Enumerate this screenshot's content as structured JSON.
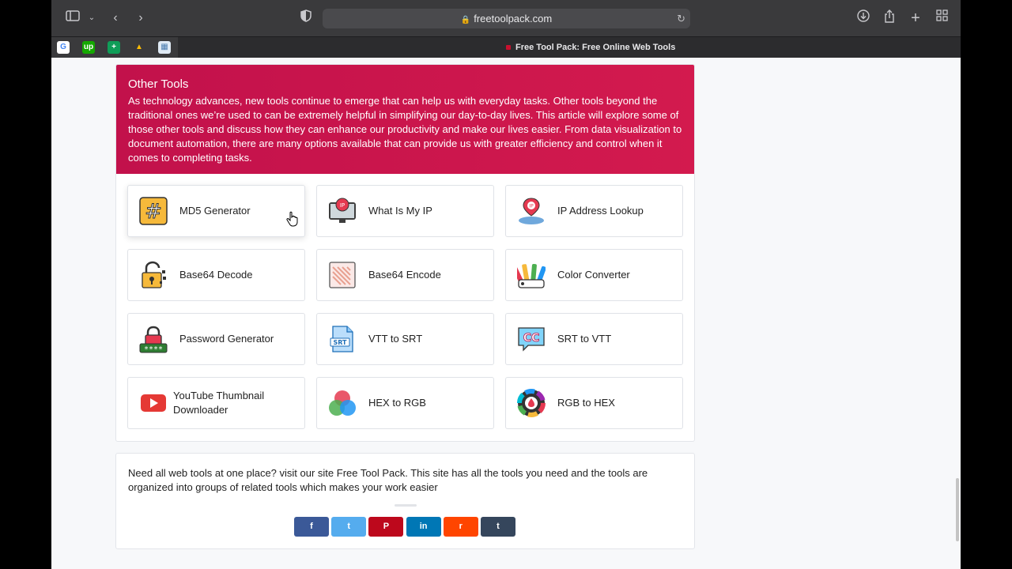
{
  "browser": {
    "url": "freetoolpack.com",
    "tab_title": "Free Tool Pack: Free Online Web Tools",
    "favorites": [
      {
        "name": "google",
        "glyph": "G",
        "color": "#ffffff",
        "text": "#4285f4"
      },
      {
        "name": "upwork",
        "glyph": "up",
        "color": "#14a800",
        "text": "#ffffff"
      },
      {
        "name": "sheets",
        "glyph": "+",
        "color": "#0f9d58",
        "text": "#ffffff"
      },
      {
        "name": "drive",
        "glyph": "▲",
        "color": "#3a3a3c",
        "text": "#fbbc04"
      },
      {
        "name": "app",
        "glyph": "▦",
        "color": "#dfeaf5",
        "text": "#4a7cb0"
      }
    ]
  },
  "hero": {
    "title": "Other Tools",
    "description": "As technology advances, new tools continue to emerge that can help us with everyday tasks. Other tools beyond the traditional ones we’re used to can be extremely helpful in simplifying our day-to-day lives. This article will explore some of those other tools and discuss how they can enhance our productivity and make our lives easier. From data visualization to document automation, there are many options available that can provide us with greater efficiency and control when it comes to completing tasks."
  },
  "tools": [
    {
      "label": "MD5 Generator",
      "icon": "hash-icon"
    },
    {
      "label": "What Is My IP",
      "icon": "ip-monitor-icon"
    },
    {
      "label": "IP Address Lookup",
      "icon": "ip-location-icon"
    },
    {
      "label": "Base64 Decode",
      "icon": "padlock-open-icon"
    },
    {
      "label": "Base64 Encode",
      "icon": "image-pattern-icon"
    },
    {
      "label": "Color Converter",
      "icon": "color-swatch-icon"
    },
    {
      "label": "Password Generator",
      "icon": "password-lock-icon"
    },
    {
      "label": "VTT to SRT",
      "icon": "srt-file-icon"
    },
    {
      "label": "SRT to VTT",
      "icon": "cc-bubble-icon"
    },
    {
      "label": "YouTube Thumbnail Downloader",
      "icon": "youtube-icon"
    },
    {
      "label": "HEX to RGB",
      "icon": "rgb-circles-icon"
    },
    {
      "label": "RGB to HEX",
      "icon": "color-wheel-icon"
    }
  ],
  "footer": {
    "text": "Need all web tools at one place? visit our site Free Tool Pack. This site has all the tools you need and the tools are organized into groups of related tools which  makes your work easier"
  },
  "share_buttons": [
    {
      "name": "facebook",
      "glyph": "f",
      "color": "#3b5998"
    },
    {
      "name": "twitter",
      "glyph": "t",
      "color": "#55acee"
    },
    {
      "name": "pinterest",
      "glyph": "P",
      "color": "#bd081c"
    },
    {
      "name": "linkedin",
      "glyph": "in",
      "color": "#0077b5"
    },
    {
      "name": "reddit",
      "glyph": "r",
      "color": "#ff4500"
    },
    {
      "name": "tumblr",
      "glyph": "t",
      "color": "#35465c"
    }
  ]
}
